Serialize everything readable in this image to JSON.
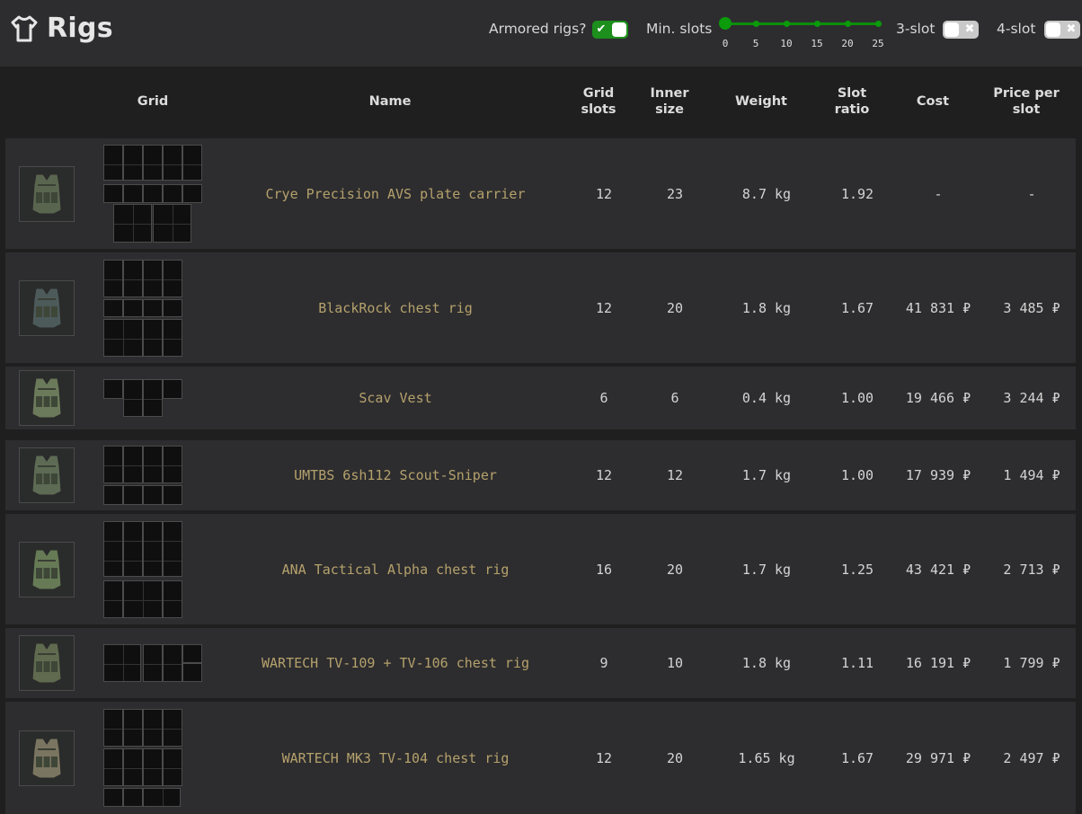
{
  "title": "Rigs",
  "title_icon": "shirt-icon",
  "controls": {
    "armored_label": "Armored rigs?",
    "armored_on": true,
    "min_slots_label": "Min. slots",
    "min_slots_value": 0,
    "slider_ticks": [
      "0",
      "5",
      "10",
      "15",
      "20",
      "25"
    ],
    "slot3_label": "3-slot",
    "slot3_on": false,
    "slot4_label": "4-slot",
    "slot4_on": false,
    "accent_color": "#1c8f1c"
  },
  "columns": {
    "grid": "Grid",
    "name": "Name",
    "grid_slots": "Grid\nslots",
    "inner_size": "Inner\nsize",
    "weight": "Weight",
    "slot_ratio": "Slot\nratio",
    "cost": "Cost",
    "price_per_slot": "Price per\nslot"
  },
  "rows": [
    {
      "name": "Crye Precision AVS plate carrier",
      "grid_slots": "12",
      "inner_size": "23",
      "weight": "8.7 kg",
      "slot_ratio": "1.92",
      "cost": "-",
      "price_per_slot": "-",
      "icon": "plate-carrier-icon"
    },
    {
      "name": "BlackRock chest rig",
      "grid_slots": "12",
      "inner_size": "20",
      "weight": "1.8 kg",
      "slot_ratio": "1.67",
      "cost": "41 831 ₽",
      "price_per_slot": "3 485 ₽",
      "icon": "chest-rig-icon"
    },
    {
      "name": "Scav Vest",
      "grid_slots": "6",
      "inner_size": "6",
      "weight": "0.4 kg",
      "slot_ratio": "1.00",
      "cost": "19 466 ₽",
      "price_per_slot": "3 244 ₽",
      "icon": "vest-icon"
    },
    {
      "name": "UMTBS 6sh112 Scout-Sniper",
      "grid_slots": "12",
      "inner_size": "12",
      "weight": "1.7 kg",
      "slot_ratio": "1.00",
      "cost": "17 939 ₽",
      "price_per_slot": "1 494 ₽",
      "icon": "chest-rig-icon"
    },
    {
      "name": "ANA Tactical Alpha chest rig",
      "grid_slots": "16",
      "inner_size": "20",
      "weight": "1.7 kg",
      "slot_ratio": "1.25",
      "cost": "43 421 ₽",
      "price_per_slot": "2 713 ₽",
      "icon": "chest-rig-icon"
    },
    {
      "name": "WARTECH TV-109 + TV-106 chest rig",
      "grid_slots": "9",
      "inner_size": "10",
      "weight": "1.8 kg",
      "slot_ratio": "1.11",
      "cost": "16 191 ₽",
      "price_per_slot": "1 799 ₽",
      "icon": "chest-rig-icon"
    },
    {
      "name": "WARTECH MK3 TV-104 chest rig",
      "grid_slots": "12",
      "inner_size": "20",
      "weight": "1.65 kg",
      "slot_ratio": "1.67",
      "cost": "29 971 ₽",
      "price_per_slot": "2 497 ₽",
      "icon": "chest-rig-icon"
    }
  ]
}
